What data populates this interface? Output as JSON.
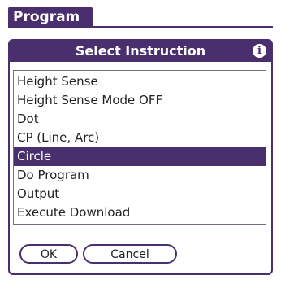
{
  "app": {
    "title": "Program"
  },
  "dialog": {
    "title": "Select Instruction",
    "info_icon": "i",
    "items": [
      {
        "label": "Height Sense",
        "selected": false
      },
      {
        "label": "Height Sense Mode OFF",
        "selected": false
      },
      {
        "label": "Dot",
        "selected": false
      },
      {
        "label": "CP (Line, Arc)",
        "selected": false
      },
      {
        "label": "Circle",
        "selected": true
      },
      {
        "label": "Do Program",
        "selected": false
      },
      {
        "label": "Output",
        "selected": false
      },
      {
        "label": "Execute Download",
        "selected": false
      }
    ],
    "buttons": {
      "ok": "OK",
      "cancel": "Cancel"
    }
  },
  "colors": {
    "accent": "#4a2f6e",
    "background": "#ffffff"
  }
}
